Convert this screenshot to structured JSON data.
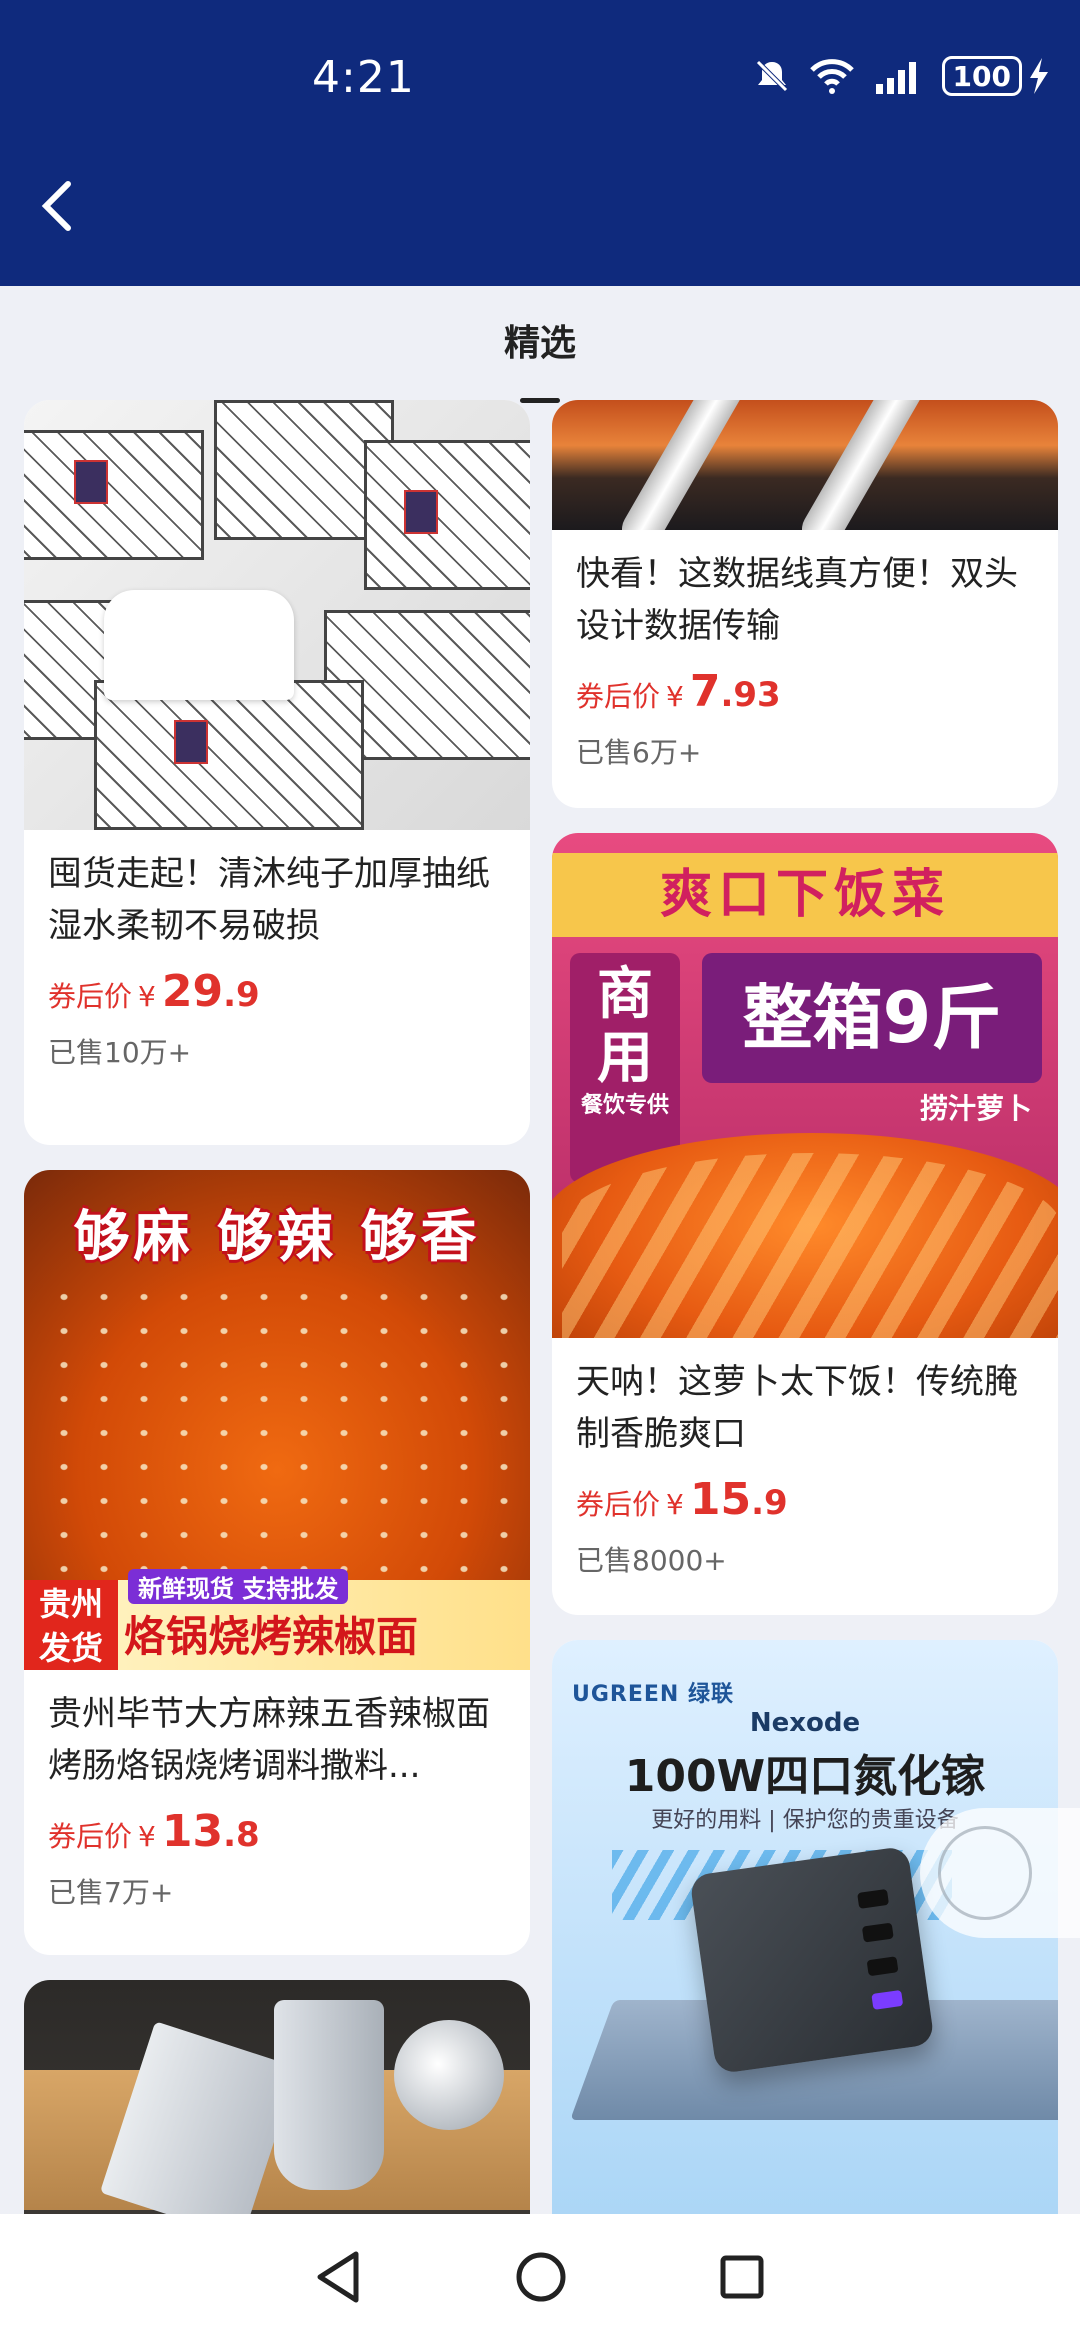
{
  "status": {
    "time": "4:21",
    "battery": "100"
  },
  "tab": {
    "label": "精选"
  },
  "cards": [
    {
      "title": "囤货走起！清沐纯子加厚抽纸湿水柔韧不易破损",
      "price_label": "券后价",
      "yen": "¥",
      "price_int": "29",
      "price_dec": ".9",
      "sold": "已售10万+"
    },
    {
      "title": "快看！这数据线真方便！双头设计数据传输",
      "price_label": "券后价",
      "yen": "¥",
      "price_int": "7",
      "price_dec": ".93",
      "sold": "已售6万+"
    },
    {
      "title": "天呐！这萝卜太下饭！传统腌制香脆爽口",
      "price_label": "券后价",
      "yen": "¥",
      "price_int": "15",
      "price_dec": ".9",
      "sold": "已售8000+"
    },
    {
      "title": "贵州毕节大方麻辣五香辣椒面烤肠烙锅烧烤调料撒料...",
      "price_label": "券后价",
      "yen": "¥",
      "price_int": "13",
      "price_dec": ".8",
      "sold": "已售7万+"
    }
  ],
  "images": {
    "radish": {
      "banner": "爽口下饭菜",
      "side_main": "商用",
      "side_sub": "餐饮专供",
      "big": "整箱9斤",
      "sub": "捞汁萝卜"
    },
    "chili": {
      "headline": "够麻 够辣 够香",
      "region": "贵州发货",
      "tags": "新鲜现货 支持批发",
      "main": "烙锅烧烤辣椒面"
    },
    "charger": {
      "brand": "UGREEN 绿联",
      "nexode": "Nexode",
      "title": "100W四口氮化镓",
      "sub": "更好的用料 | 保护您的贵重设备"
    }
  }
}
